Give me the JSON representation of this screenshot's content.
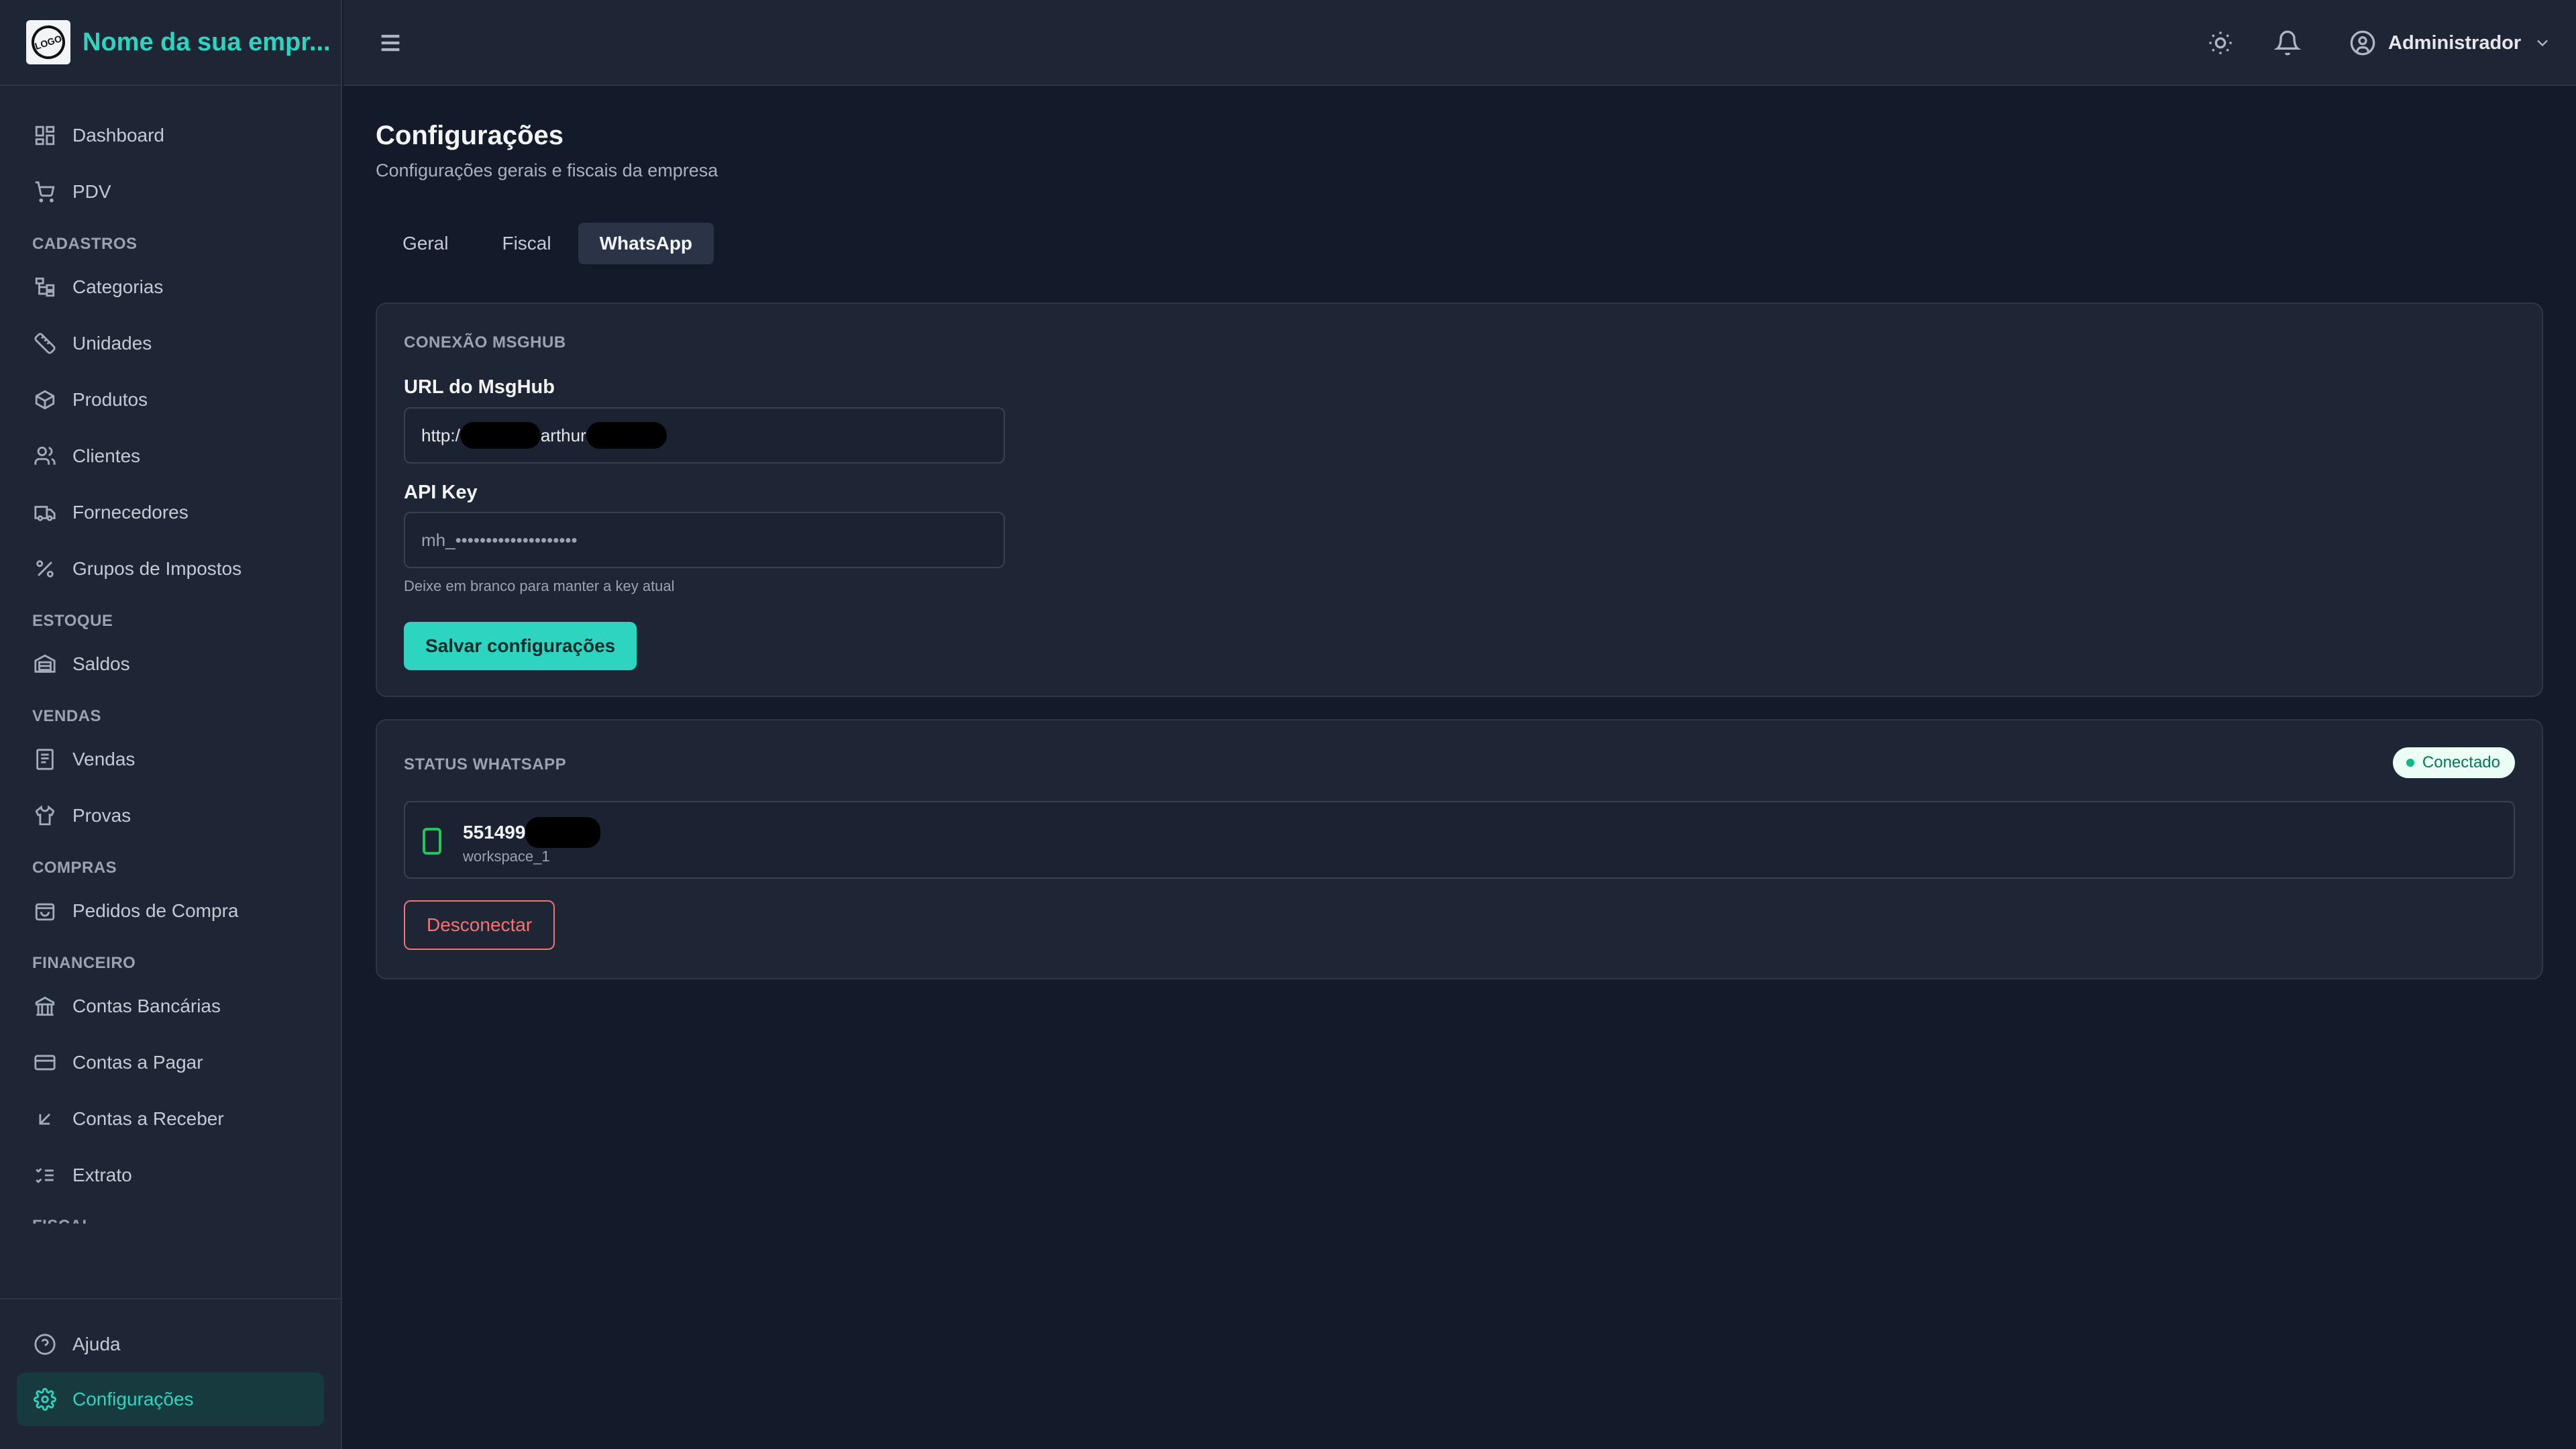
{
  "app": {
    "brand_name": "Nome da sua empr...",
    "logo_text": "LOGO"
  },
  "sidebar": {
    "top_items": [
      {
        "label": "Dashboard",
        "icon": "dashboard-icon"
      },
      {
        "label": "PDV",
        "icon": "cart-icon"
      }
    ],
    "sections": [
      {
        "title": "CADASTROS",
        "items": [
          {
            "label": "Categorias",
            "icon": "tree-icon"
          },
          {
            "label": "Unidades",
            "icon": "ruler-icon"
          },
          {
            "label": "Produtos",
            "icon": "box-icon"
          },
          {
            "label": "Clientes",
            "icon": "users-icon"
          },
          {
            "label": "Fornecedores",
            "icon": "truck-icon"
          },
          {
            "label": "Grupos de Impostos",
            "icon": "percent-icon"
          }
        ]
      },
      {
        "title": "ESTOQUE",
        "items": [
          {
            "label": "Saldos",
            "icon": "warehouse-icon"
          }
        ]
      },
      {
        "title": "VENDAS",
        "items": [
          {
            "label": "Vendas",
            "icon": "receipt-icon"
          },
          {
            "label": "Provas",
            "icon": "shirt-icon"
          }
        ]
      },
      {
        "title": "COMPRAS",
        "items": [
          {
            "label": "Pedidos de Compra",
            "icon": "shopping-bag-icon"
          }
        ]
      },
      {
        "title": "FINANCEIRO",
        "items": [
          {
            "label": "Contas Bancárias",
            "icon": "bank-icon"
          },
          {
            "label": "Contas a Pagar",
            "icon": "credit-card-icon"
          },
          {
            "label": "Contas a Receber",
            "icon": "arrow-down-left-icon"
          },
          {
            "label": "Extrato",
            "icon": "list-checks-icon"
          }
        ]
      },
      {
        "title": "FISCAL",
        "items": []
      }
    ],
    "bottom_items": [
      {
        "label": "Ajuda",
        "icon": "help-circle-icon"
      },
      {
        "label": "Configurações",
        "icon": "gear-icon",
        "active": true
      }
    ]
  },
  "header": {
    "user_name": "Administrador"
  },
  "main": {
    "title": "Configurações",
    "subtitle": "Configurações gerais e fiscais da empresa",
    "tabs": [
      {
        "label": "Geral",
        "active": false
      },
      {
        "label": "Fiscal",
        "active": false
      },
      {
        "label": "WhatsApp",
        "active": true
      }
    ],
    "connection_card": {
      "title": "CONEXÃO MSGHUB",
      "url_label": "URL do MsgHub",
      "url_value_prefix": "http:/",
      "url_value_middle": "arthur",
      "api_key_label": "API Key",
      "api_key_placeholder": "mh_••••••••••••••••••••",
      "hint": "Deixe em branco para manter a key atual",
      "save_label": "Salvar configurações"
    },
    "status_card": {
      "title": "STATUS WHATSAPP",
      "badge_label": "Conectado",
      "phone_number": "551499",
      "workspace": "workspace_1",
      "disconnect_label": "Desconectar"
    }
  },
  "colors": {
    "accent": "#2dd4bf",
    "background": "#131b2b",
    "panel": "#1e2635",
    "danger": "#f87171",
    "success": "#10b981"
  }
}
